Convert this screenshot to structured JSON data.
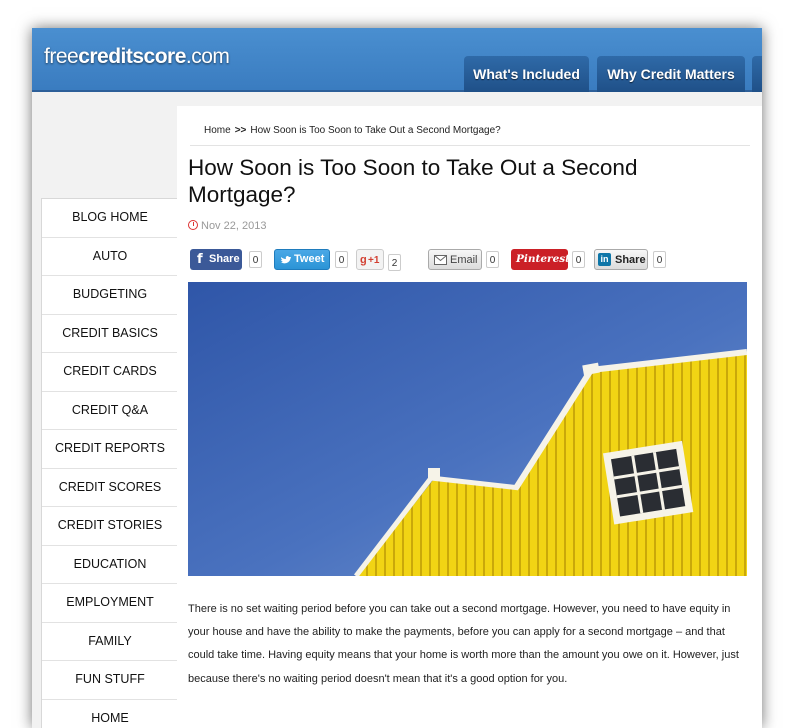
{
  "header": {
    "logo_prefix": "free",
    "logo_bold": "creditscore",
    "logo_suffix": ".com",
    "tabs": [
      {
        "label": "What's Included"
      },
      {
        "label": "Why Credit Matters"
      }
    ]
  },
  "sidebar": {
    "items": [
      {
        "label": "BLOG HOME"
      },
      {
        "label": "AUTO"
      },
      {
        "label": "BUDGETING"
      },
      {
        "label": "CREDIT BASICS"
      },
      {
        "label": "CREDIT CARDS"
      },
      {
        "label": "CREDIT Q&A"
      },
      {
        "label": "CREDIT REPORTS"
      },
      {
        "label": "CREDIT SCORES"
      },
      {
        "label": "CREDIT STORIES"
      },
      {
        "label": "EDUCATION"
      },
      {
        "label": "EMPLOYMENT"
      },
      {
        "label": "FAMILY"
      },
      {
        "label": "FUN STUFF"
      },
      {
        "label": "HOME"
      }
    ]
  },
  "breadcrumb": {
    "home": "Home",
    "separator": ">>",
    "current": "How Soon is Too Soon to Take Out a Second Mortgage?"
  },
  "article": {
    "title": "How Soon is Too Soon to Take Out a Second Mortgage?",
    "date": "Nov 22, 2013",
    "body": "There is no set waiting period before you can take out a second mortgage. However, you need to have equity in your house and have the ability to make the payments, before you can apply for a second mortgage – and that could take time. Having equity means that your home is worth more than the amount you owe on it. However, just because there's no waiting period doesn't mean that it's a good option for you."
  },
  "share": {
    "facebook": {
      "label": "Share",
      "count": "0",
      "color": "#3b5998"
    },
    "twitter": {
      "label": "Tweet",
      "count": "0",
      "color": "#2b94d6"
    },
    "gplus": {
      "label": "+1",
      "count": "2",
      "color": "#d23f31"
    },
    "email": {
      "label": "Email",
      "count": "0"
    },
    "pinterest": {
      "label": "Pinterest",
      "count": "0",
      "color": "#cb2027"
    },
    "linkedin": {
      "label": "Share",
      "count": "0",
      "color": "#0e76a8"
    }
  },
  "colors": {
    "header_blue": "#3a7cc0",
    "tab_blue": "#1f5088",
    "house_yellow": "#f0d410",
    "sky_blue": "#3f68b8"
  }
}
